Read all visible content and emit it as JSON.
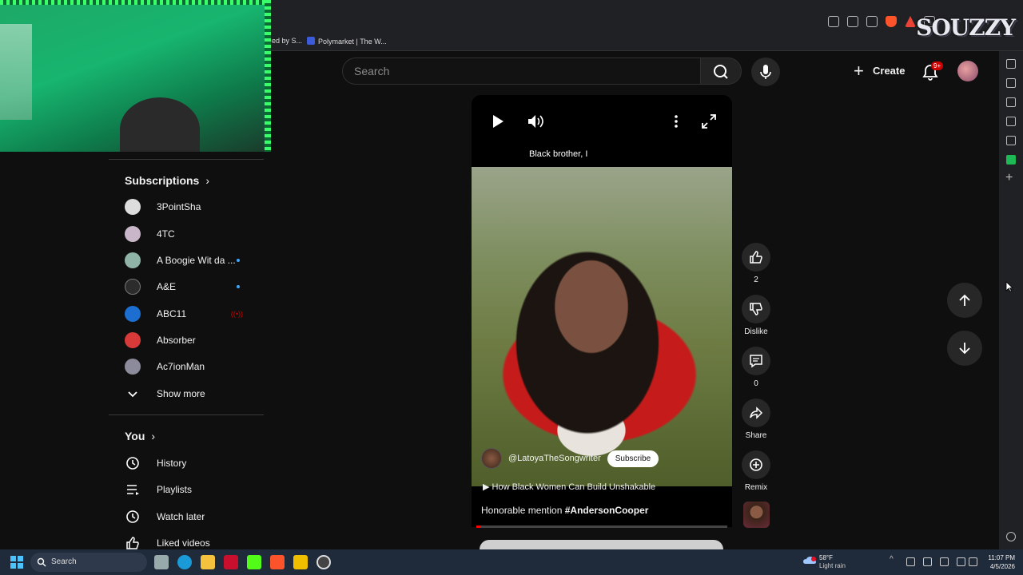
{
  "browser": {
    "bookmarks": [
      {
        "label": "ed by S..."
      },
      {
        "label": "Polymarket | The W..."
      }
    ],
    "watermark": "SOUZZY"
  },
  "header": {
    "search_placeholder": "Search",
    "create_label": "Create",
    "notification_count": "9+"
  },
  "leftnav": {
    "subscriptions_title": "Subscriptions",
    "subscriptions": [
      {
        "label": "3PointSha",
        "indicator": "none",
        "color": "#dddddd"
      },
      {
        "label": "4TC",
        "indicator": "none",
        "color": "#c9b7c9"
      },
      {
        "label": "A Boogie Wit da ...",
        "indicator": "dot",
        "color": "#8fb3a6"
      },
      {
        "label": "A&E",
        "indicator": "dot",
        "color": "#2c2c2c"
      },
      {
        "label": "ABC11",
        "indicator": "live",
        "color": "#1c6fd1"
      },
      {
        "label": "Absorber",
        "indicator": "none",
        "color": "#d83a3a"
      },
      {
        "label": "Ac7ionMan",
        "indicator": "none",
        "color": "#8b8b9b"
      }
    ],
    "show_more": "Show more",
    "you_title": "You",
    "you_items": [
      {
        "label": "History",
        "icon": "history-icon"
      },
      {
        "label": "Playlists",
        "icon": "playlists-icon"
      },
      {
        "label": "Watch later",
        "icon": "watch-later-icon"
      },
      {
        "label": "Liked videos",
        "icon": "like-icon"
      }
    ]
  },
  "short": {
    "caption": "Black brother, I",
    "channel": "@LatoyaTheSongwriter",
    "subscribe_label": "Subscribe",
    "song": "How Black Women Can Build Unshakable",
    "description_prefix": "Honorable mention",
    "description_tag": "#AndersonCooper",
    "progress_percent": 2
  },
  "actions": {
    "likes": "2",
    "dislike_label": "Dislike",
    "comments": "0",
    "share_label": "Share",
    "remix_label": "Remix"
  },
  "taskbar": {
    "search_label": "Search",
    "weather_temp": "58°F",
    "weather_desc": "Light rain",
    "time": "11:07 PM",
    "date": "4/5/2026"
  },
  "colors": {
    "accent": "#ff0000",
    "background": "#0f0f0f",
    "webcam_led": "#39ff6a"
  }
}
